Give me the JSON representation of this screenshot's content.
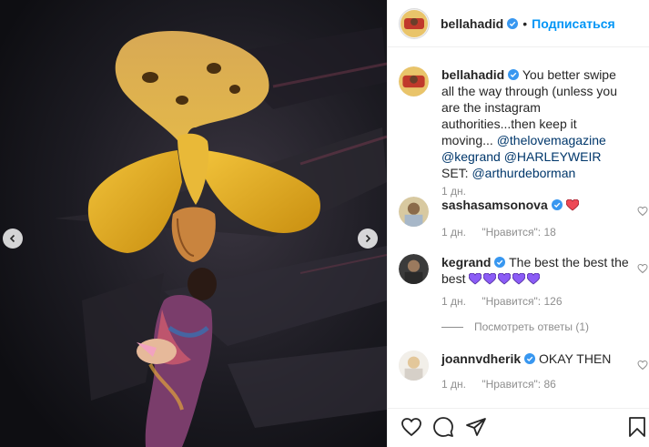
{
  "post": {
    "author": "bellahadid",
    "follow_label": "Подписаться",
    "separator": "•"
  },
  "caption": {
    "username": "bellahadid",
    "text_1": "You better swipe all the way through (unless you are the instagram authorities...then keep it moving...",
    "mention_1": "@thelovemagazine",
    "mention_2": "@kegrand",
    "mention_3": "@HARLEYWEIR",
    "text_2": "SET:",
    "mention_4": "@arthurdeborman",
    "time": "1 дн."
  },
  "comments": [
    {
      "username": "sashasamsonova",
      "text": "",
      "time": "1 дн.",
      "likes": "\"Нравится\": 18",
      "emoji": "red-heart"
    },
    {
      "username": "kegrand",
      "text": "The best the best the best",
      "time": "1 дн.",
      "likes": "\"Нравится\": 126",
      "emoji": "purple-hearts-5"
    },
    {
      "username": "joannvdherik",
      "text": "OKAY THEN",
      "time": "1 дн.",
      "likes": "\"Нравится\": 86"
    }
  ],
  "view_replies": "Посмотреть ответы (1)",
  "colors": {
    "accent": "#0095f6",
    "verified": "#3897f0",
    "heart_red": "#ed4956",
    "purple": "#8b5cf6",
    "text_muted": "#8e8e8e",
    "media_bg": "#141418"
  },
  "icons": {
    "nav_prev": "chevron-left-icon",
    "nav_next": "chevron-right-icon",
    "like": "heart-outline-icon",
    "comment": "comment-bubble-icon",
    "share": "paper-plane-icon",
    "save": "bookmark-icon"
  }
}
